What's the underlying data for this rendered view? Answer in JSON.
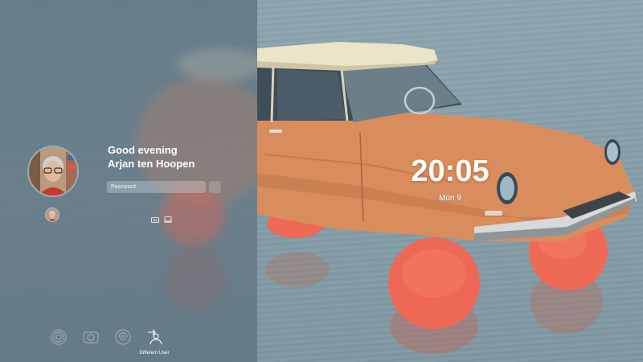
{
  "greeting": {
    "line1": "Good evening",
    "line2": "Arjan ten Hoopen"
  },
  "password": {
    "placeholder": "Password",
    "value": ""
  },
  "bottom_bar": {
    "icons": [
      "fingerprint-icon",
      "camera-icon",
      "face-id-icon",
      "different-user-icon"
    ],
    "different_user_label": "Different User"
  },
  "clock": {
    "time": "20:05",
    "date": "Mon 9"
  },
  "colors": {
    "panel": "#5c727e",
    "car_body": "#d98d5c",
    "car_roof": "#ece4c9",
    "balloon": "#ef6a55",
    "water": "#86a0aa"
  }
}
